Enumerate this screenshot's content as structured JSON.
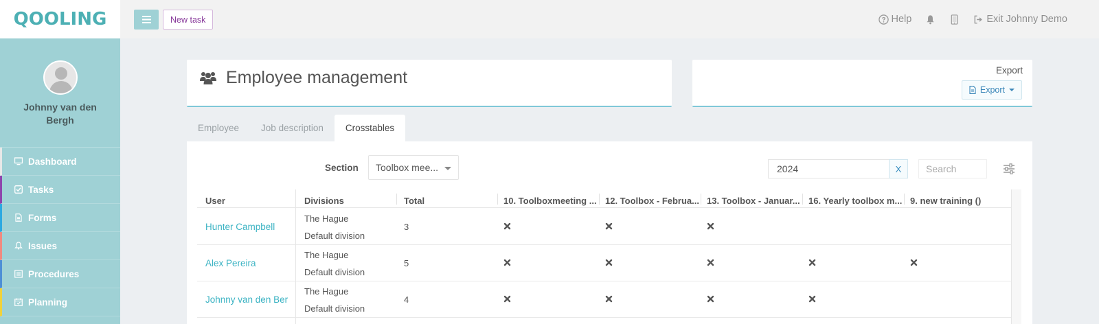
{
  "brand": {
    "logo_text": "QOOLING"
  },
  "profile": {
    "name": "Johnny van den Bergh"
  },
  "sidebar": {
    "items": [
      {
        "label": "Dashboard",
        "icon": "monitor-icon",
        "accent": "#e8e8e8"
      },
      {
        "label": "Tasks",
        "icon": "check-square-icon",
        "accent": "#8e44ad"
      },
      {
        "label": "Forms",
        "icon": "document-icon",
        "accent": "#2ca9e1"
      },
      {
        "label": "Issues",
        "icon": "bell-icon",
        "accent": "#f08a80"
      },
      {
        "label": "Procedures",
        "icon": "list-icon",
        "accent": "#4d8fd6"
      },
      {
        "label": "Planning",
        "icon": "calendar-icon",
        "accent": "#f1d23b"
      }
    ]
  },
  "topbar": {
    "menu_icon": "hamburger-icon",
    "new_task_label": "New task",
    "help_label": "Help",
    "exit_label": "Exit Johnny Demo"
  },
  "header": {
    "title": "Employee management",
    "icon": "users-icon"
  },
  "export": {
    "label": "Export",
    "button_label": "Export"
  },
  "tabs": [
    {
      "label": "Employee",
      "active": false
    },
    {
      "label": "Job description",
      "active": false
    },
    {
      "label": "Crosstables",
      "active": true
    }
  ],
  "filters": {
    "section_label": "Section",
    "section_value": "Toolbox mee...",
    "year_value": "2024",
    "clear_label": "X",
    "search_placeholder": "Search"
  },
  "table": {
    "columns": [
      "User",
      "Divisions",
      "Total",
      "10. Toolboxmeeting ...",
      "12. Toolbox - Februa...",
      "13. Toolbox - Januar...",
      "16. Yearly toolbox m...",
      "9. new training ()"
    ],
    "rows": [
      {
        "user": "Hunter Campbell",
        "division_1": "The Hague",
        "division_2": "Default division",
        "total": "3",
        "marks": [
          true,
          true,
          true,
          false,
          false
        ]
      },
      {
        "user": "Alex Pereira",
        "division_1": "The Hague",
        "division_2": "Default division",
        "total": "5",
        "marks": [
          true,
          true,
          true,
          true,
          true
        ]
      },
      {
        "user": "Johnny van den Bergh",
        "division_1": "The Hague",
        "division_2": "Default division",
        "total": "4",
        "marks": [
          true,
          true,
          true,
          true,
          false
        ]
      }
    ]
  }
}
